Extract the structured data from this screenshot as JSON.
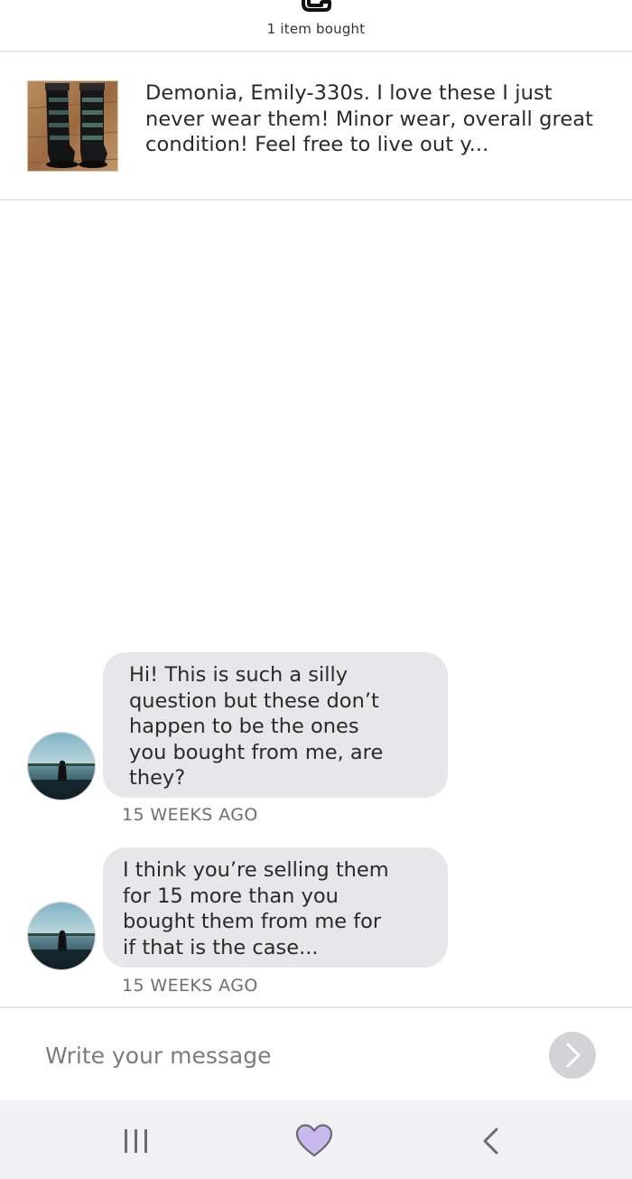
{
  "header": {
    "icon": "shopping-bag-icon",
    "items_bought": "1 item bought"
  },
  "product": {
    "thumbnail": "boots-photo",
    "description": "Demonia, Emily-330s. I love these I just never wear them! Minor wear, overall great condition! Feel free to live out y..."
  },
  "messages": [
    {
      "avatar": "profile-photo-woman-in-water",
      "lines": [
        "Hi! This is such a silly",
        "question but these don’t",
        "happen to be the ones",
        "you bought from me, are",
        "they?"
      ],
      "time": "15 WEEKS AGO"
    },
    {
      "avatar": "profile-photo-woman-in-water",
      "lines": [
        "I think you’re selling them",
        "for 15 more than you",
        "bought them from me for",
        "if that is the case..."
      ],
      "time": "15 WEEKS AGO"
    }
  ],
  "composer": {
    "placeholder": "Write your message",
    "value": "",
    "send_icon": "chevron-right-icon"
  },
  "navbar": {
    "recent_icon": "recent-apps-icon",
    "home_icon": "heart-icon",
    "back_icon": "back-chevron-icon"
  },
  "colors": {
    "bubble_bg": "#e7e7ea",
    "heart_fill": "#c9b9ef",
    "heart_stroke": "#6a6a70",
    "send_button_bg": "#d3d3d6",
    "divider": "#e6e6e8"
  }
}
